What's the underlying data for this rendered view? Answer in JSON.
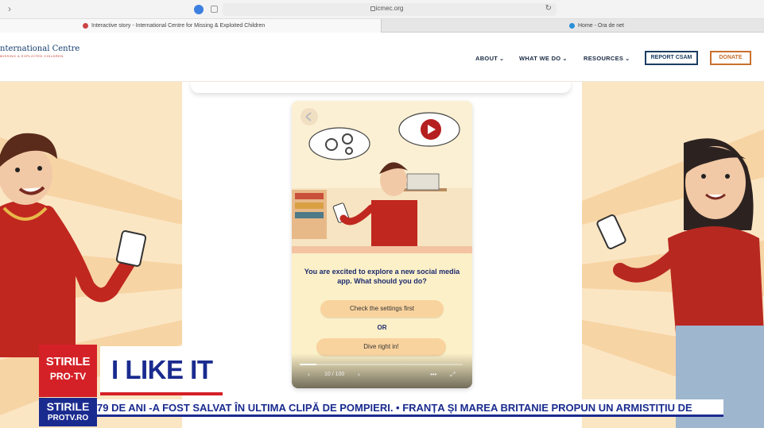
{
  "browser": {
    "address": "icmec.org",
    "tabs": [
      {
        "label": "Interactive story - International Centre for Missing & Exploited Children"
      },
      {
        "label": "Home - Ora de net"
      }
    ]
  },
  "site": {
    "logo_text": "nternational Centre",
    "logo_sub": "MISSING & EXPLOITED CHILDREN",
    "nav": [
      {
        "label": "ABOUT"
      },
      {
        "label": "WHAT WE DO"
      },
      {
        "label": "RESOURCES"
      }
    ],
    "report_label": "REPORT CSAM",
    "donate_label": "DONATE"
  },
  "story": {
    "prompt": "You are excited to explore a new social media app. What should you do?",
    "choice1": "Check the settings first",
    "or_label": "OR",
    "choice2": "Dive right in!",
    "page_counter": "10 / 100",
    "progress": 0.1
  },
  "overlay": {
    "logo_line1": "STIRILE",
    "logo_line2": "PRO·TV",
    "logo2_line1": "STIRILE",
    "logo2_line2": "PROTV.RO",
    "headline": "I LIKE IT",
    "ticker": "79 DE ANI -A FOST SALVAT ÎN ULTIMA CLIPĂ DE POMPIERI.   •   FRANȚA ȘI MAREA BRITANIE PROPUN UN ARMISTIȚIU DE"
  },
  "colors": {
    "accent_red": "#d42127",
    "accent_blue": "#1a2b8f",
    "navy": "#1b3d63",
    "donate_orange": "#c9702e",
    "page_bg": "#fbe9cc"
  }
}
